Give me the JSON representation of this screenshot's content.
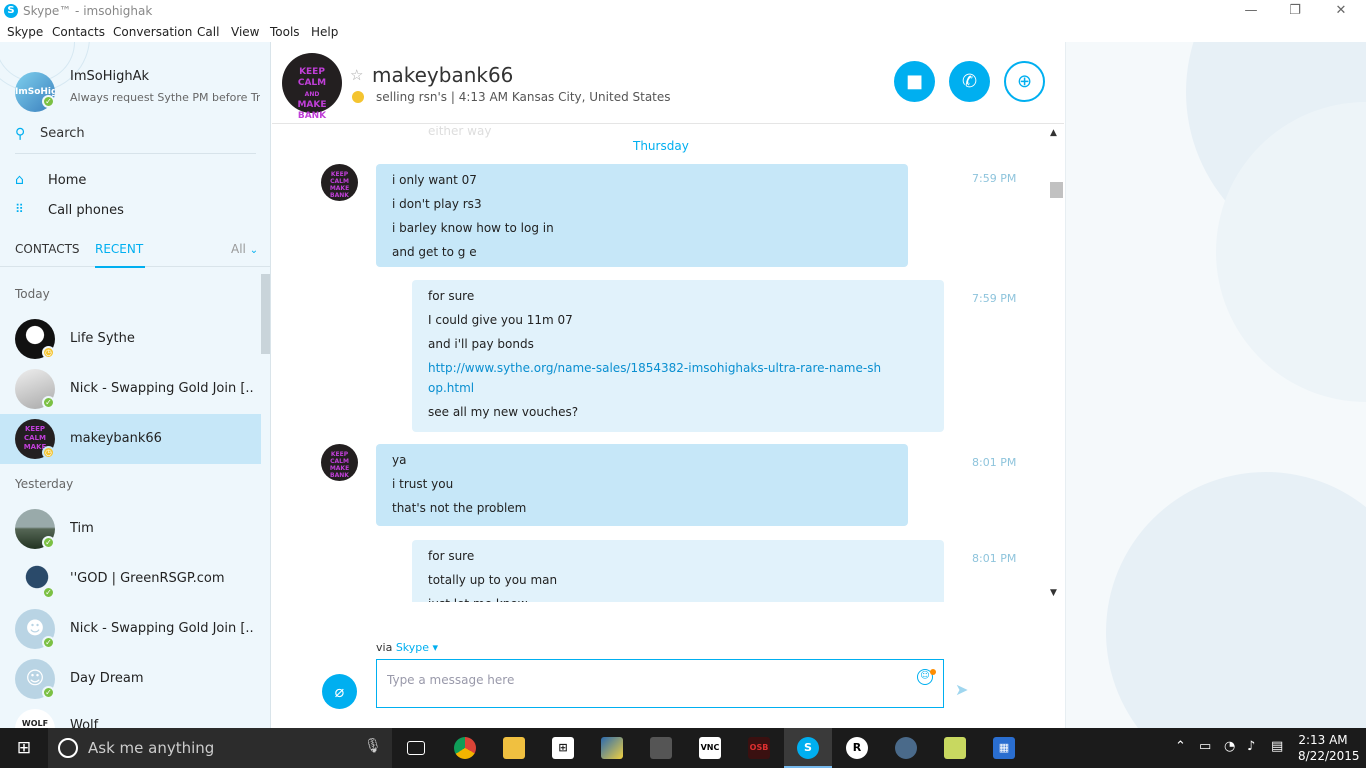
{
  "window": {
    "title": "Skype™ - imsohighak",
    "controls": {
      "minimize": "—",
      "restore": "❐",
      "close": "✕"
    }
  },
  "menu": [
    "Skype",
    "Contacts",
    "Conversation",
    "Call",
    "View",
    "Tools",
    "Help"
  ],
  "profile": {
    "name": "ImSoHighAk",
    "mood": "Always request Sythe PM before Tr...",
    "avatar_text": "ImSoHighAk",
    "status": "online"
  },
  "sidebar": {
    "search_label": "Search",
    "nav": [
      {
        "label": "Home",
        "icon": "home-icon"
      },
      {
        "label": "Call phones",
        "icon": "dialpad-icon"
      }
    ],
    "tabs": {
      "contacts": "CONTACTS",
      "recent": "RECENT",
      "filter": "All"
    },
    "groups": {
      "today": "Today",
      "yesterday": "Yesterday"
    },
    "recent": [
      {
        "name": "Life Sythe",
        "status": "away"
      },
      {
        "name": "Nick - Swapping Gold Join [...",
        "status": "online"
      },
      {
        "name": "makeybank66",
        "status": "away",
        "selected": true
      },
      {
        "name": "Tim",
        "status": "online"
      },
      {
        "name": "''GOD | GreenRSGP.com",
        "status": "online"
      },
      {
        "name": "Nick - Swapping Gold Join [...",
        "status": "online"
      },
      {
        "name": "Day Dream",
        "status": "online"
      },
      {
        "name": "Wolf",
        "status": "online"
      }
    ]
  },
  "chat": {
    "name": "makeybank66",
    "status": "selling rsn's | 4:13 AM Kansas City, United States",
    "avatar_lines": [
      "KEEP",
      "CALM",
      "AND",
      "MAKE",
      "BANK"
    ],
    "faded_text": "either way",
    "day_label": "Thursday",
    "messages": [
      {
        "from": "them",
        "time": "7:59 PM",
        "lines": [
          "i only want 07",
          "i don't play rs3",
          "i barley know how to log in",
          "and get to g e"
        ]
      },
      {
        "from": "me",
        "time": "7:59 PM",
        "lines": [
          "for sure",
          "I could give you 11m 07",
          "and i'll pay bonds"
        ],
        "link": "http://www.sythe.org/name-sales/1854382-imsohighaks-ultra-rare-name-shop.html",
        "after": "see all my new vouches?"
      },
      {
        "from": "them",
        "time": "8:01 PM",
        "lines": [
          "ya",
          "i trust you",
          "that's not the problem"
        ]
      },
      {
        "from": "me",
        "time": "8:01 PM",
        "lines": [
          "for sure",
          "totally up to you man",
          "just let me know"
        ]
      }
    ],
    "compose": {
      "via_prefix": "via",
      "via_service": "Skype",
      "placeholder": "Type a message here"
    }
  },
  "taskbar": {
    "search_placeholder": "Ask me anything",
    "time": "2:13 AM",
    "date": "8/22/2015",
    "apps": [
      "task-view",
      "chrome",
      "file-explorer",
      "store",
      "drawing-app",
      "dvd-app",
      "vnc-viewer",
      "osb",
      "skype",
      "runelite",
      "steam",
      "folder",
      "calculator"
    ]
  },
  "colors": {
    "skype_blue": "#00aff0",
    "online": "#7bc043",
    "away": "#f4c430",
    "bubble_in": "#c6e7f8",
    "bubble_out": "#e1f2fb"
  }
}
